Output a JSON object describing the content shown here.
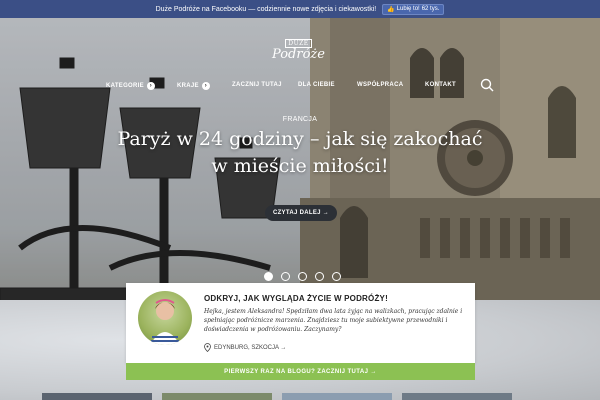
{
  "facebook_bar": {
    "text": "Duże Podróże na Facebooku — codziennie nowe zdjęcia i ciekawostki!",
    "like_label": "Lubię to!",
    "like_count": "62 tys."
  },
  "logo": {
    "line1": "DUŻE",
    "line2": "Podróże"
  },
  "nav": {
    "items": [
      {
        "label": "KATEGORIE",
        "has_arrow": true
      },
      {
        "label": "KRAJE",
        "has_arrow": true
      },
      {
        "label": "ZACZNIJ TUTAJ",
        "has_arrow": false
      },
      {
        "label": "DLA CIEBIE",
        "has_arrow": false
      },
      {
        "label": "WSPÓŁPRACA",
        "has_arrow": false
      },
      {
        "label": "KONTAKT",
        "has_arrow": false
      }
    ]
  },
  "hero": {
    "category": "FRANCJA",
    "title_line1": "Paryż w 24 godziny – jak się zakochać",
    "title_line2": "w mieście miłości!",
    "read_more": "CZYTAJ DALEJ →",
    "slides": 5,
    "active_slide": 1
  },
  "intro_card": {
    "title": "ODKRYJ, JAK WYGLĄDA ŻYCIE W PODRÓŻY!",
    "text": "Hejka, jestem Aleksandra! Spędziłam dwa lata żyjąc na walizkach, pracując zdalnie i spełniając podróżnicze marzenia. Znajdziesz tu moje subiektywne przewodniki i doświadczenia w podróżowaniu. Zaczynamy?",
    "location": "EDYNBURG, SZKOCJA →",
    "cta": "PIERWSZY RAZ NA BLOGU? ZACZNIJ TUTAJ →"
  },
  "colors": {
    "fb_bar": "#3b4f86",
    "cta_green": "#8cc153",
    "button_dark": "#2c3036"
  }
}
